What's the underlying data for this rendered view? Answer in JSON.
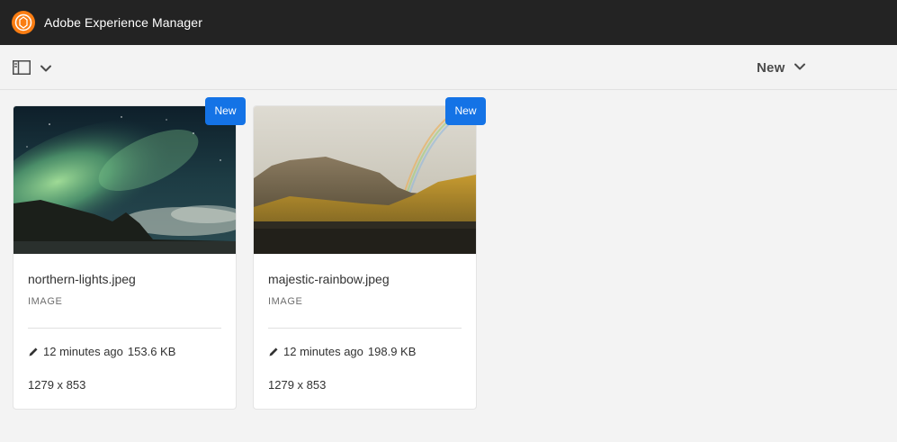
{
  "header": {
    "app_title": "Adobe Experience Manager",
    "logo_icon": "adobe-experience-manager-logo"
  },
  "actionbar": {
    "rail_toggle_icon": "side-rail-icon",
    "rail_chevron_icon": "chevron-down-icon",
    "new_label": "New",
    "new_chevron_icon": "chevron-down-icon"
  },
  "colors": {
    "topbar": "#232323",
    "logo": "#fa7d13",
    "badge": "#1473e6",
    "background": "#f3f3f3"
  },
  "cards": [
    {
      "badge": "New",
      "name": "northern-lights.jpeg",
      "type": "IMAGE",
      "modified": "12 minutes ago",
      "size": "153.6 KB",
      "dimensions": "1279 x 853",
      "thumbnail": "aurora-borealis-photo"
    },
    {
      "badge": "New",
      "name": "majestic-rainbow.jpeg",
      "type": "IMAGE",
      "modified": "12 minutes ago",
      "size": "198.9 KB",
      "dimensions": "1279 x 853",
      "thumbnail": "mountain-rainbow-photo"
    }
  ]
}
